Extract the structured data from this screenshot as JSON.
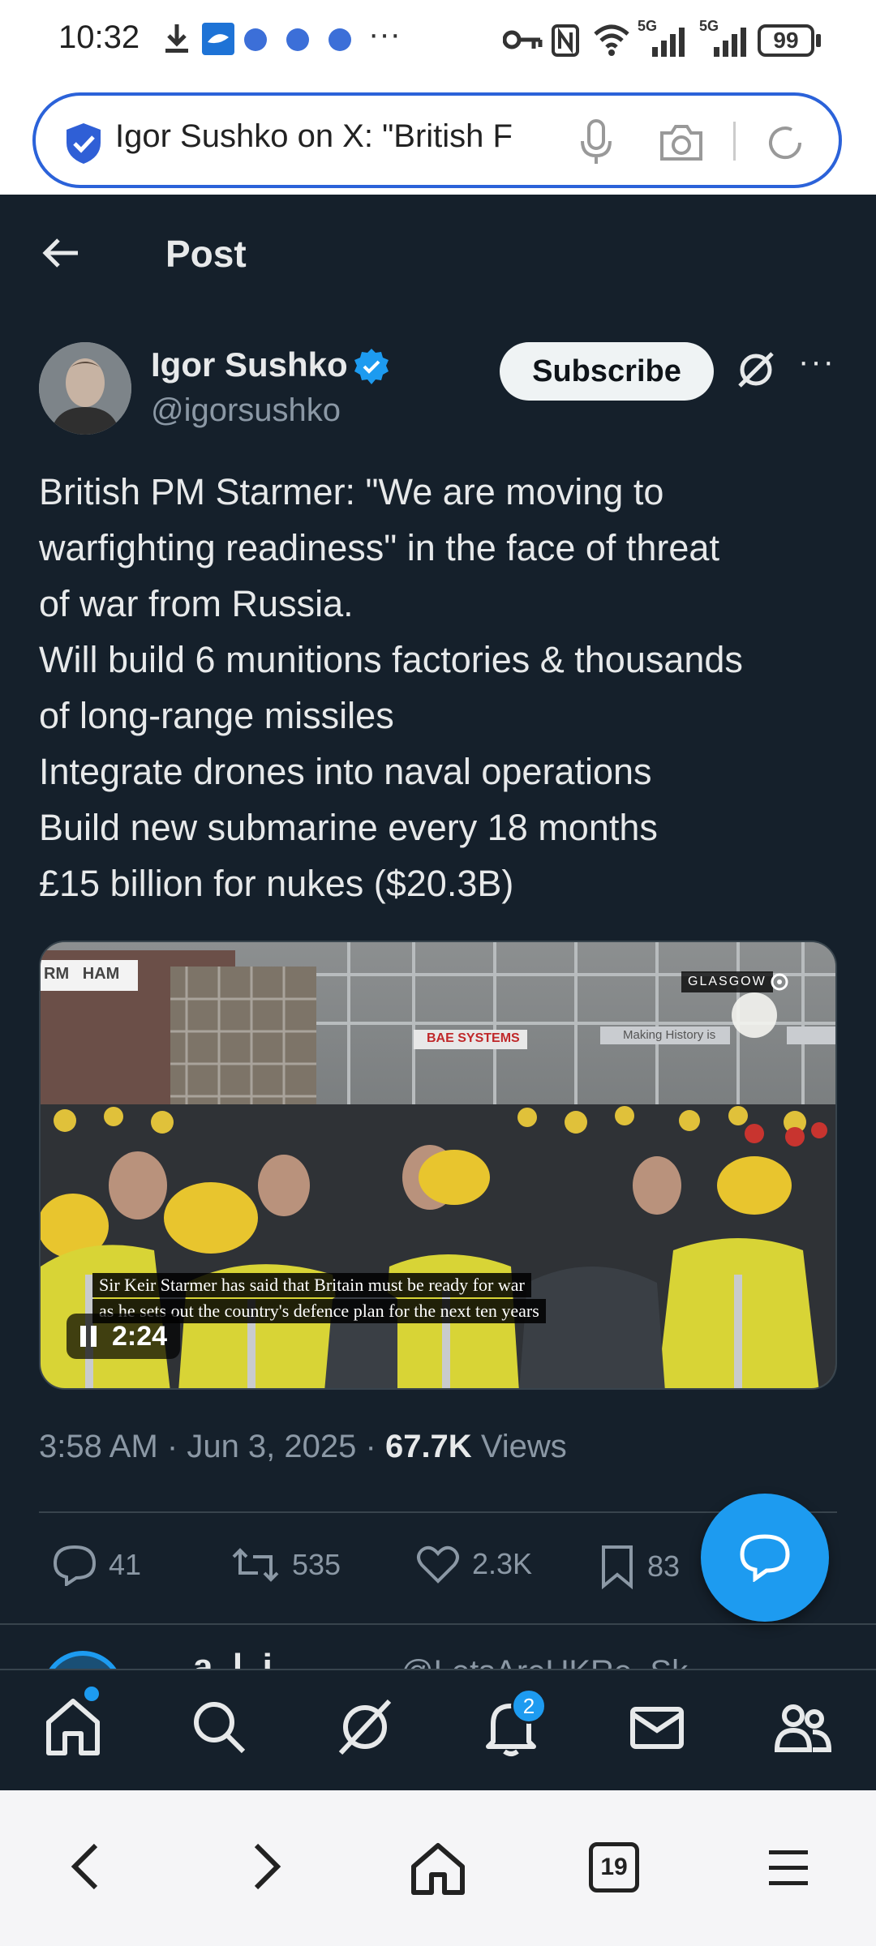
{
  "status_bar": {
    "time": "10:32",
    "battery": "99",
    "network1": "5G",
    "network2": "5G"
  },
  "browser": {
    "url_title": "Igor Sushko on X: \"British F",
    "tab_count": "19"
  },
  "header": {
    "title": "Post"
  },
  "post": {
    "author_name": "Igor Sushko",
    "author_handle": "@igorsushko",
    "subscribe_label": "Subscribe",
    "text_lines": [
      "British PM Starmer: \"We are moving to",
      "warfighting readiness\" in the face of threat",
      "of war from Russia.",
      "Will build 6 munitions factories & thousands",
      "of long-range missiles",
      "Integrate drones into naval operations",
      "Build new submarine every 18 months",
      "£15 billion for nukes ($20.3B)"
    ],
    "video": {
      "location_tag": "GLASGOW",
      "caption_line1": "Sir Keir Starmer has said that Britain must be ready for war",
      "caption_line2": "as he sets out the country's defence plan for the next ten years",
      "duration": "2:24",
      "sign_left": "RM   HAM",
      "sign_center": "BAE SYSTEMS",
      "sign_right": "Making History is"
    },
    "time": "3:58 AM",
    "date": "Jun 3, 2025",
    "views_count": "67.7K",
    "views_label": "Views",
    "replies": "41",
    "reposts": "535",
    "likes": "2.3K",
    "bookmarks": "83"
  },
  "next_reply_preview": {
    "name_fragment": "a..l..i..",
    "handle_fragment": "@LetsAreUKRe..Sk.."
  },
  "nav": {
    "notifications_badge": "2"
  },
  "colors": {
    "background": "#15202b",
    "accent": "#1d9bf0",
    "verified": "#1d9bf0",
    "secondary_text": "#8b98a5"
  }
}
